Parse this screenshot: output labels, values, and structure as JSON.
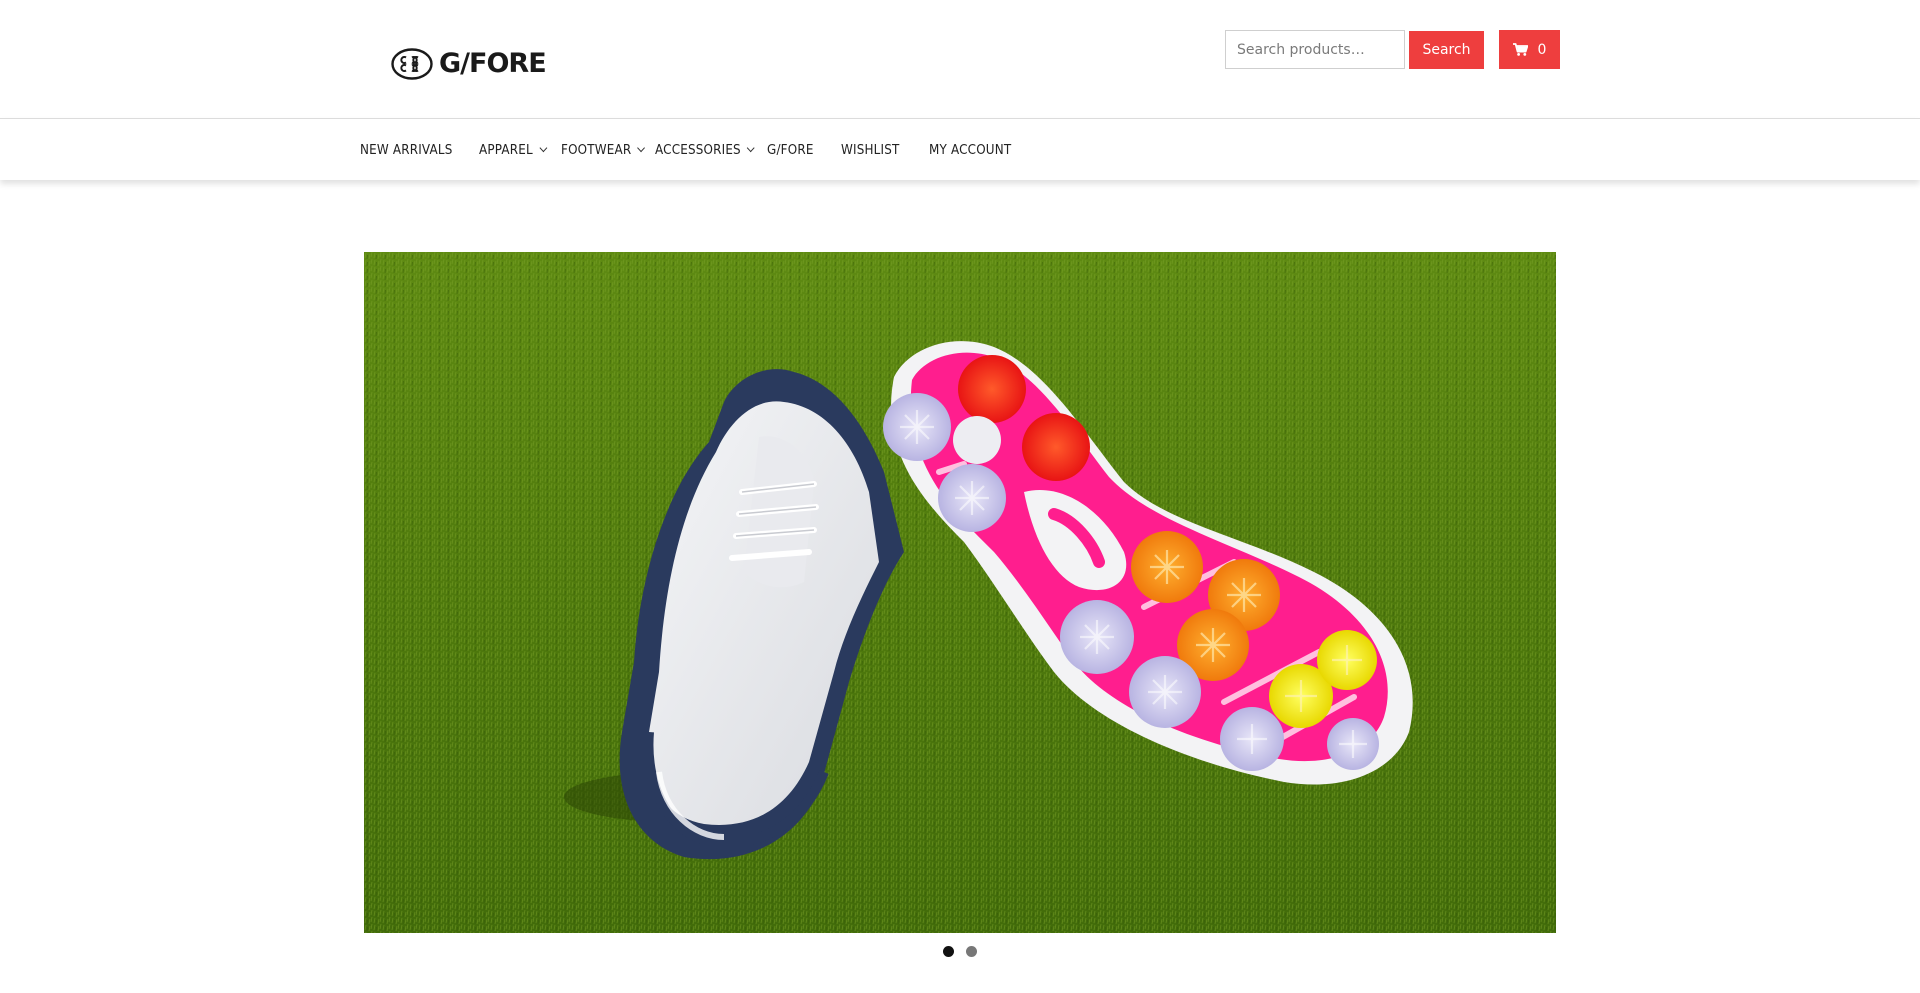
{
  "brand": {
    "name": "G/FORE",
    "accent_color": "#ee3e3e"
  },
  "header": {
    "search": {
      "placeholder": "Search products…",
      "value": "",
      "button_label": "Search"
    },
    "cart": {
      "icon": "cart-icon",
      "count": "0"
    }
  },
  "nav": {
    "items": [
      {
        "label": "NEW ARRIVALS",
        "has_dropdown": false
      },
      {
        "label": "APPAREL",
        "has_dropdown": true
      },
      {
        "label": "FOOTWEAR",
        "has_dropdown": true
      },
      {
        "label": "ACCESSORIES",
        "has_dropdown": true
      },
      {
        "label": "G/FORE",
        "has_dropdown": false
      },
      {
        "label": "WISHLIST",
        "has_dropdown": false
      },
      {
        "label": "MY ACCOUNT",
        "has_dropdown": false
      }
    ]
  },
  "slider": {
    "current_slide": 1,
    "slide_count": 2
  }
}
